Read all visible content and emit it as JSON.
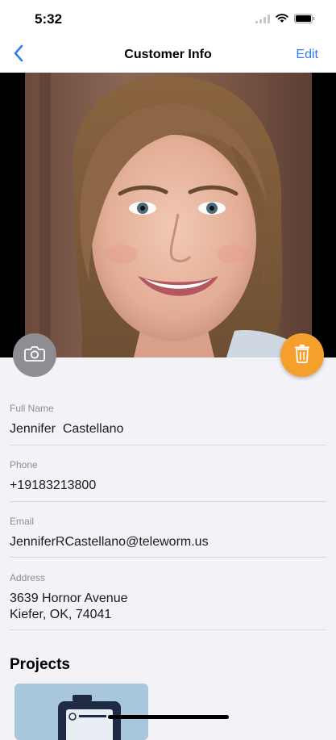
{
  "status_bar": {
    "time": "5:32"
  },
  "nav": {
    "title": "Customer Info",
    "edit_label": "Edit"
  },
  "fields": [
    {
      "label": "Full Name",
      "value": "Jennifer  Castellano"
    },
    {
      "label": "Phone",
      "value": "+19183213800"
    },
    {
      "label": "Email",
      "value": "JenniferRCastellano@teleworm.us"
    },
    {
      "label": "Address",
      "value_line1": "3639 Hornor Avenue",
      "value_line2": "Kiefer, OK, 74041"
    }
  ],
  "projects": {
    "title": "Projects"
  },
  "colors": {
    "accent": "#2f7cf6",
    "delete": "#f5a02d",
    "camera": "#8d8d92",
    "project_card": "#a8c6dc"
  }
}
